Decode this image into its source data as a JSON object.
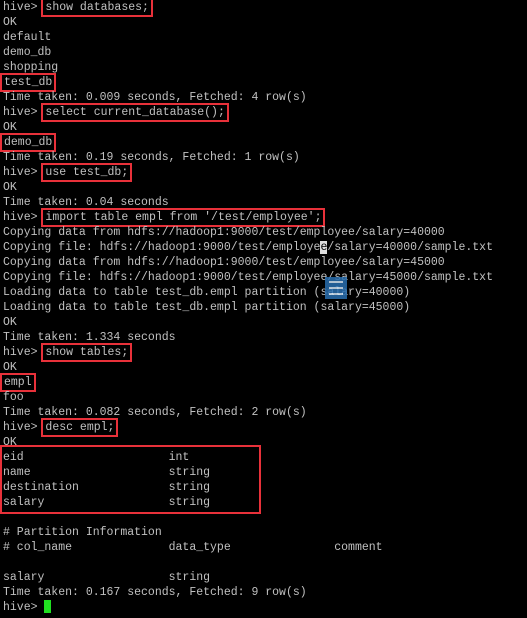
{
  "prompt": "hive> ",
  "lines": [
    {
      "cmd": "show databases;"
    },
    {
      "text": "OK"
    },
    {
      "text": "default"
    },
    {
      "text": "demo_db"
    },
    {
      "text": "shopping"
    },
    {
      "text": "test_db",
      "highlight": true
    },
    {
      "text": "Time taken: 0.009 seconds, Fetched: 4 row(s)"
    },
    {
      "cmd": "select current_database();"
    },
    {
      "text": "OK"
    },
    {
      "text": "demo_db",
      "highlight": true
    },
    {
      "text": "Time taken: 0.19 seconds, Fetched: 1 row(s)"
    },
    {
      "cmd": "use test_db;"
    },
    {
      "text": "OK"
    },
    {
      "text": "Time taken: 0.04 seconds"
    },
    {
      "cmd": "import table empl from '/test/employee';"
    },
    {
      "text": "Copying data from hdfs://hadoop1:9000/test/employee/salary=40000"
    },
    {
      "text": "Copying file: hdfs://hadoop1:9000/test/employee/salary=40000/sample.txt"
    },
    {
      "text": "Copying data from hdfs://hadoop1:9000/test/employee/salary=45000"
    },
    {
      "text": "Copying file: hdfs://hadoop1:9000/test/employee/salary=45000/sample.txt"
    },
    {
      "text": "Loading data to table test_db.empl partition (salary=40000)"
    },
    {
      "text": "Loading data to table test_db.empl partition (salary=45000)"
    },
    {
      "text": "OK"
    },
    {
      "text": "Time taken: 1.334 seconds"
    },
    {
      "cmd": "show tables;"
    },
    {
      "text": "OK"
    },
    {
      "text": "empl",
      "highlight": true
    },
    {
      "text": "foo"
    },
    {
      "text": "Time taken: 0.082 seconds, Fetched: 2 row(s)"
    },
    {
      "cmd": "desc empl;"
    },
    {
      "text": "OK"
    },
    {
      "text": "eid                     int"
    },
    {
      "text": "name                    string"
    },
    {
      "text": "destination             string"
    },
    {
      "text": "salary                  string"
    },
    {
      "text": ""
    },
    {
      "text": "# Partition Information"
    },
    {
      "text": "# col_name              data_type               comment"
    },
    {
      "text": ""
    },
    {
      "text": "salary                  string"
    },
    {
      "text": "Time taken: 0.167 seconds, Fetched: 9 row(s)"
    },
    {
      "prompt_only": true
    }
  ],
  "colors": {
    "text": "#c0c0c0",
    "highlight": "#e8313a",
    "cursor": "#21e021",
    "background": "#000000"
  }
}
